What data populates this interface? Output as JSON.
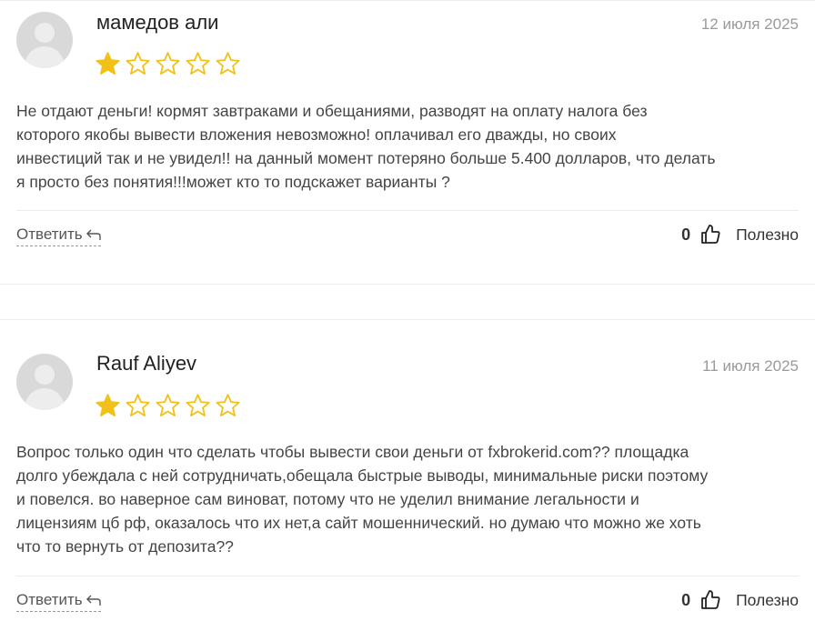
{
  "colors": {
    "star_filled": "#f2c118",
    "star_outline": "#f2c118"
  },
  "reviews": [
    {
      "author": "мамедов али",
      "date": "12 июля 2025",
      "rating": 1,
      "max_rating": 5,
      "text_lines": [
        "Не отдают деньги! кормят завтраками и обещаниями, разводят на оплату налога без",
        "которого якобы вывести вложения невозможно! оплачивал его дважды, но своих",
        "инвестиций так и не увидел!! на данный момент потеряно больше 5.400 долларов, что делать",
        "я просто без понятия!!!может кто то подскажет варианты ?"
      ],
      "reply_label": "Ответить",
      "votes": "0",
      "useful_label": "Полезно"
    },
    {
      "author": "Rauf Aliyev",
      "date": "11 июля 2025",
      "rating": 1,
      "max_rating": 5,
      "text_lines": [
        "Вопрос только один что сделать чтобы вывести свои деньги от fxbrokerid.com?? площадка",
        "долго убеждала с ней сотрудничать,обещала быстрые выводы, минимальные риски поэтому",
        "и повелся. во наверное сам виноват, потому что не уделил внимание легальности и",
        "лицензиям цб рф, оказалось что их нет,а сайт мошеннический. но думаю что можно же хоть",
        "что то вернуть от депозита??"
      ],
      "reply_label": "Ответить",
      "votes": "0",
      "useful_label": "Полезно"
    }
  ]
}
